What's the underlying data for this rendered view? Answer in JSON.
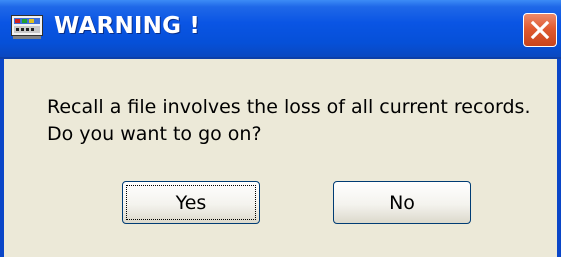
{
  "window": {
    "title": "WARNING !",
    "icon": "app-window-icon"
  },
  "titlebar_buttons": {
    "close_icon": "close-icon"
  },
  "dialog": {
    "message_line1": "Recall a file involves the loss of all current records.",
    "message_line2": "Do you want to go on?"
  },
  "buttons": {
    "yes_label": "Yes",
    "no_label": "No"
  },
  "colors": {
    "titlebar": "#0a55e4",
    "window_border": "#0a46c8",
    "body_bg": "#ece9d8",
    "close_button": "#e05a31"
  }
}
